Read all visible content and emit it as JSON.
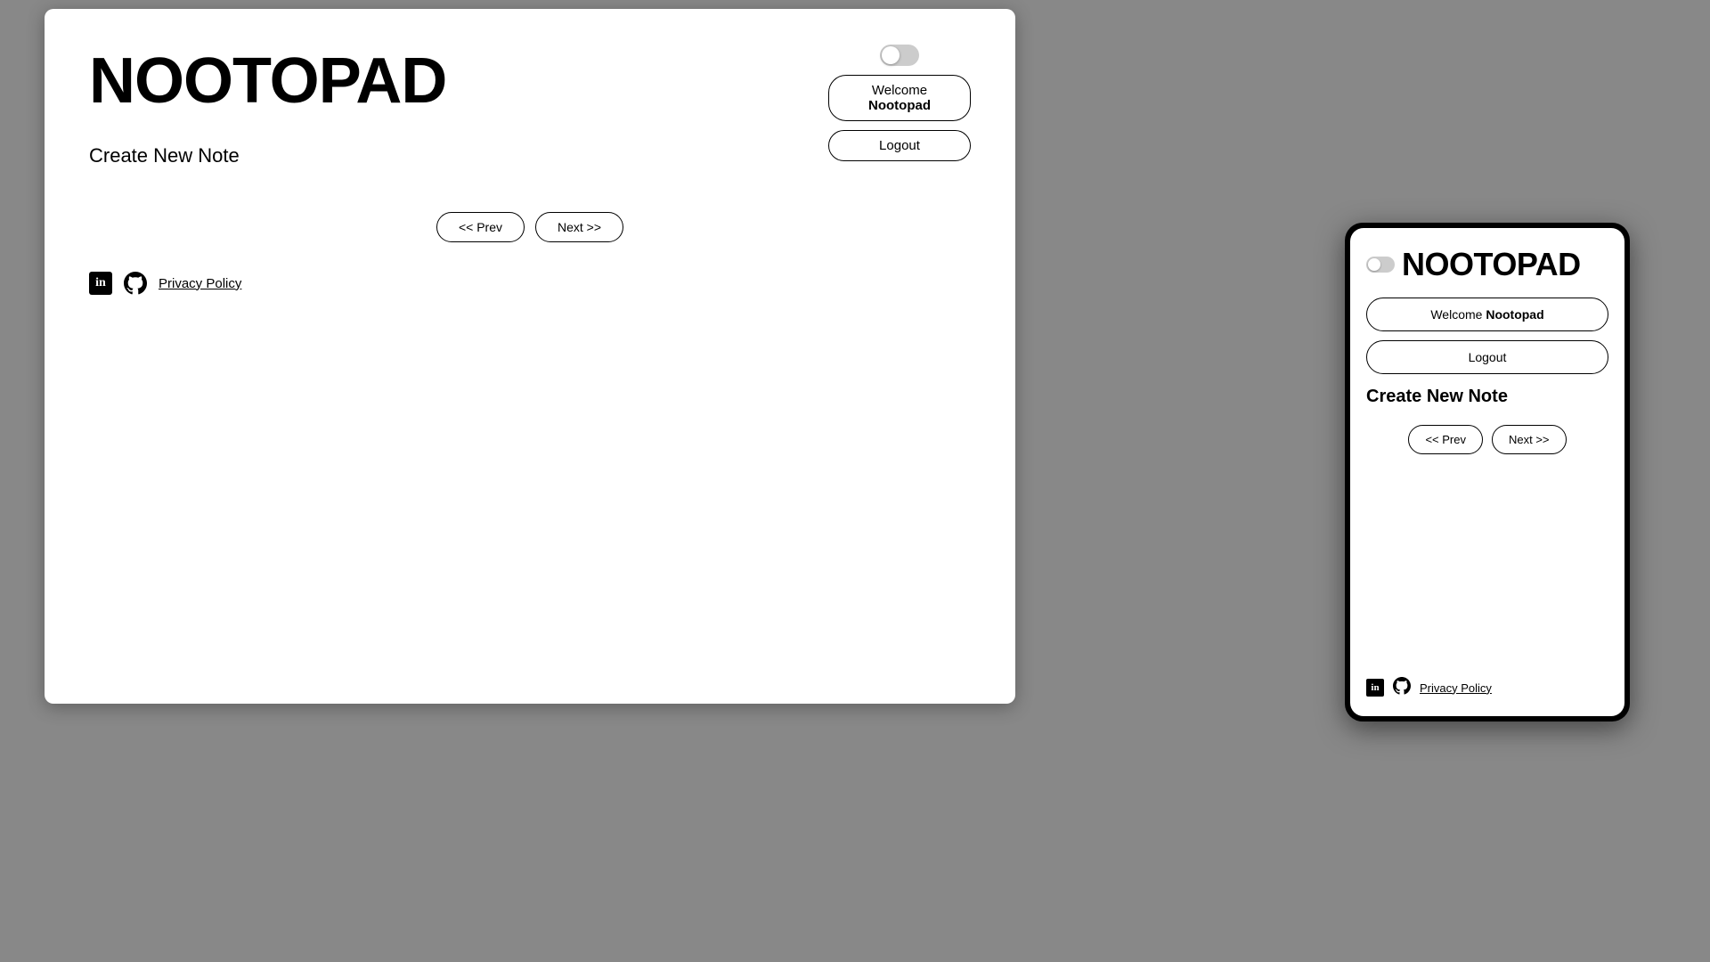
{
  "desktop": {
    "logo": "NOOTOPAD",
    "welcome_btn": {
      "prefix": "Welcome ",
      "username": "Nootopad"
    },
    "logout_btn": "Logout",
    "section_title": "Create New Note",
    "prev_btn": "<< Prev",
    "next_btn": "Next >>",
    "privacy_policy": "Privacy Policy"
  },
  "mobile": {
    "logo": "NOOTOPAD",
    "welcome_btn": {
      "prefix": "Welcome ",
      "username": "Nootopad"
    },
    "logout_btn": "Logout",
    "section_title": "Create New Note",
    "prev_btn": "<< Prev",
    "next_btn": "Next >>",
    "privacy_policy": "Privacy Policy"
  },
  "icons": {
    "linkedin": "in",
    "github": "⊙"
  }
}
